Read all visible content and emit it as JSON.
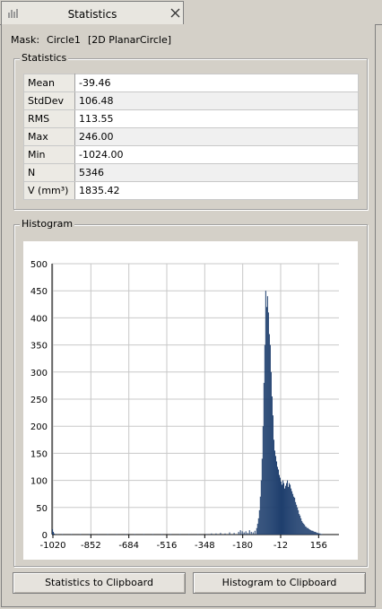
{
  "tab": {
    "title": "Statistics",
    "icon": "chart-icon",
    "close_icon": "close-icon"
  },
  "mask": {
    "label": "Mask:",
    "name": "Circle1",
    "type": "[2D PlanarCircle]"
  },
  "statistics": {
    "title": "Statistics",
    "rows": [
      {
        "key": "Mean",
        "value": "-39.46"
      },
      {
        "key": "StdDev",
        "value": "106.48"
      },
      {
        "key": "RMS",
        "value": "113.55"
      },
      {
        "key": "Max",
        "value": "246.00"
      },
      {
        "key": "Min",
        "value": "-1024.00"
      },
      {
        "key": "N",
        "value": "5346"
      },
      {
        "key": "V (mm³)",
        "value": "1835.42"
      }
    ]
  },
  "histogram": {
    "title": "Histogram",
    "bar_color": "#1f3f6e"
  },
  "chart_data": {
    "type": "bar",
    "x_ticks": [
      "-1020",
      "-852",
      "-684",
      "-516",
      "-348",
      "-180",
      "-12",
      "156"
    ],
    "y_ticks": [
      "0",
      "50",
      "100",
      "150",
      "200",
      "250",
      "300",
      "350",
      "400",
      "450",
      "500"
    ],
    "xlim": [
      -1024,
      246
    ],
    "ylim": [
      0,
      500
    ],
    "grid": true,
    "bin_width": 4,
    "bins": [
      {
        "x": -1024,
        "y": 10
      },
      {
        "x": -1020,
        "y": 5
      },
      {
        "x": -1016,
        "y": 2
      },
      {
        "x": -1000,
        "y": 1
      },
      {
        "x": -980,
        "y": 1
      },
      {
        "x": -940,
        "y": 1
      },
      {
        "x": -900,
        "y": 1
      },
      {
        "x": -860,
        "y": 1
      },
      {
        "x": -820,
        "y": 1
      },
      {
        "x": -780,
        "y": 1
      },
      {
        "x": -740,
        "y": 1
      },
      {
        "x": -700,
        "y": 1
      },
      {
        "x": -660,
        "y": 1
      },
      {
        "x": -620,
        "y": 1
      },
      {
        "x": -580,
        "y": 1
      },
      {
        "x": -540,
        "y": 1
      },
      {
        "x": -500,
        "y": 1
      },
      {
        "x": -460,
        "y": 1
      },
      {
        "x": -420,
        "y": 1
      },
      {
        "x": -380,
        "y": 1
      },
      {
        "x": -340,
        "y": 1
      },
      {
        "x": -320,
        "y": 2
      },
      {
        "x": -300,
        "y": 2
      },
      {
        "x": -280,
        "y": 3
      },
      {
        "x": -260,
        "y": 2
      },
      {
        "x": -240,
        "y": 4
      },
      {
        "x": -220,
        "y": 3
      },
      {
        "x": -200,
        "y": 5
      },
      {
        "x": -192,
        "y": 8
      },
      {
        "x": -184,
        "y": 6
      },
      {
        "x": -176,
        "y": 4
      },
      {
        "x": -168,
        "y": 6
      },
      {
        "x": -160,
        "y": 3
      },
      {
        "x": -152,
        "y": 8
      },
      {
        "x": -144,
        "y": 5
      },
      {
        "x": -136,
        "y": 4
      },
      {
        "x": -128,
        "y": 7
      },
      {
        "x": -120,
        "y": 12
      },
      {
        "x": -116,
        "y": 20
      },
      {
        "x": -112,
        "y": 30
      },
      {
        "x": -108,
        "y": 45
      },
      {
        "x": -104,
        "y": 70
      },
      {
        "x": -100,
        "y": 100
      },
      {
        "x": -96,
        "y": 140
      },
      {
        "x": -92,
        "y": 200
      },
      {
        "x": -88,
        "y": 280
      },
      {
        "x": -84,
        "y": 350
      },
      {
        "x": -80,
        "y": 450
      },
      {
        "x": -76,
        "y": 420
      },
      {
        "x": -72,
        "y": 440
      },
      {
        "x": -68,
        "y": 410
      },
      {
        "x": -64,
        "y": 370
      },
      {
        "x": -60,
        "y": 350
      },
      {
        "x": -56,
        "y": 300
      },
      {
        "x": -52,
        "y": 255
      },
      {
        "x": -48,
        "y": 220
      },
      {
        "x": -44,
        "y": 175
      },
      {
        "x": -40,
        "y": 155
      },
      {
        "x": -36,
        "y": 145
      },
      {
        "x": -32,
        "y": 135
      },
      {
        "x": -28,
        "y": 125
      },
      {
        "x": -24,
        "y": 120
      },
      {
        "x": -20,
        "y": 110
      },
      {
        "x": -16,
        "y": 105
      },
      {
        "x": -12,
        "y": 98
      },
      {
        "x": -8,
        "y": 92
      },
      {
        "x": -4,
        "y": 100
      },
      {
        "x": 0,
        "y": 95
      },
      {
        "x": 4,
        "y": 85
      },
      {
        "x": 8,
        "y": 90
      },
      {
        "x": 12,
        "y": 95
      },
      {
        "x": 16,
        "y": 100
      },
      {
        "x": 20,
        "y": 88
      },
      {
        "x": 24,
        "y": 95
      },
      {
        "x": 28,
        "y": 92
      },
      {
        "x": 32,
        "y": 85
      },
      {
        "x": 36,
        "y": 80
      },
      {
        "x": 40,
        "y": 75
      },
      {
        "x": 44,
        "y": 70
      },
      {
        "x": 48,
        "y": 68
      },
      {
        "x": 52,
        "y": 60
      },
      {
        "x": 56,
        "y": 55
      },
      {
        "x": 60,
        "y": 50
      },
      {
        "x": 64,
        "y": 45
      },
      {
        "x": 68,
        "y": 38
      },
      {
        "x": 72,
        "y": 35
      },
      {
        "x": 76,
        "y": 30
      },
      {
        "x": 80,
        "y": 25
      },
      {
        "x": 84,
        "y": 22
      },
      {
        "x": 88,
        "y": 20
      },
      {
        "x": 92,
        "y": 18
      },
      {
        "x": 96,
        "y": 15
      },
      {
        "x": 100,
        "y": 14
      },
      {
        "x": 104,
        "y": 12
      },
      {
        "x": 108,
        "y": 12
      },
      {
        "x": 112,
        "y": 10
      },
      {
        "x": 116,
        "y": 9
      },
      {
        "x": 120,
        "y": 8
      },
      {
        "x": 124,
        "y": 7
      },
      {
        "x": 128,
        "y": 7
      },
      {
        "x": 132,
        "y": 6
      },
      {
        "x": 136,
        "y": 5
      },
      {
        "x": 140,
        "y": 5
      },
      {
        "x": 144,
        "y": 4
      },
      {
        "x": 148,
        "y": 3
      },
      {
        "x": 152,
        "y": 3
      },
      {
        "x": 156,
        "y": 2
      },
      {
        "x": 160,
        "y": 2
      },
      {
        "x": 164,
        "y": 1
      },
      {
        "x": 168,
        "y": 1
      }
    ]
  },
  "buttons": {
    "stats_to_clipboard": "Statistics to Clipboard",
    "hist_to_clipboard": "Histogram to Clipboard"
  }
}
